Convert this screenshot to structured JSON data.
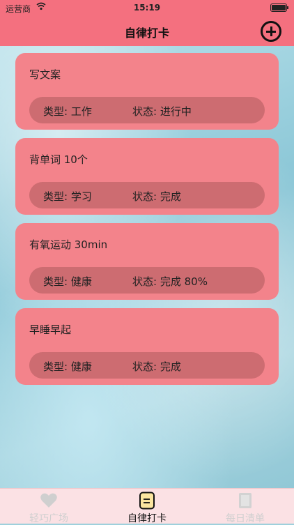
{
  "status_bar": {
    "carrier": "运营商",
    "time": "15:19"
  },
  "nav": {
    "title": "自律打卡",
    "add_icon": "plus-circle-icon"
  },
  "cards": [
    {
      "title": "写文案",
      "type_label": "类型:",
      "type_value": "工作",
      "status_label": "状态:",
      "status_value": "进行中"
    },
    {
      "title": "背单词 10个",
      "type_label": "类型:",
      "type_value": "学习",
      "status_label": "状态:",
      "status_value": "完成"
    },
    {
      "title": "有氧运动 30min",
      "type_label": "类型:",
      "type_value": "健康",
      "status_label": "状态:",
      "status_value": "完成 80%"
    },
    {
      "title": "早睡早起",
      "type_label": "类型:",
      "type_value": "健康",
      "status_label": "状态:",
      "status_value": "完成"
    }
  ],
  "tabs": [
    {
      "label": "轻巧广场",
      "icon": "heart-icon"
    },
    {
      "label": "自律打卡",
      "icon": "checklist-icon"
    },
    {
      "label": "每日清单",
      "icon": "document-icon"
    }
  ],
  "colors": {
    "header": "#f4707f",
    "card": "#f3838b",
    "card_info": "#cd6c71",
    "tab_bar": "#fbe1e4"
  }
}
